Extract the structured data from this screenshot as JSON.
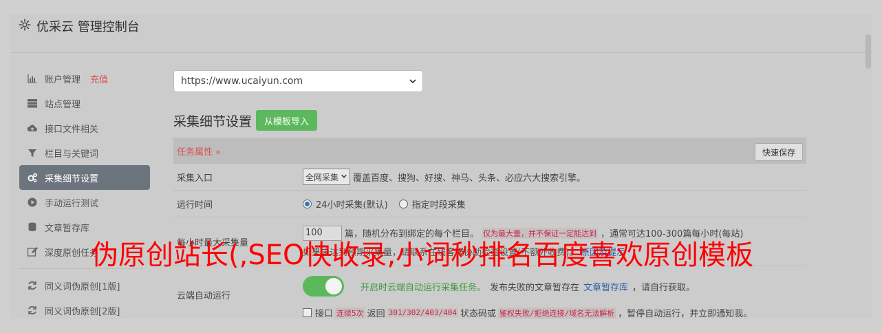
{
  "header": {
    "title": "优采云 管理控制台"
  },
  "sidebar": {
    "items": [
      {
        "label": "账户管理",
        "extra": "充值",
        "icon": "bar-chart-icon"
      },
      {
        "label": "站点管理",
        "icon": "server-icon"
      },
      {
        "label": "接口文件相关",
        "icon": "cloud-upload-icon"
      },
      {
        "label": "栏目与关键词",
        "icon": "filter-icon"
      },
      {
        "label": "采集细节设置",
        "icon": "gears-icon",
        "active": true
      },
      {
        "label": "手动运行测试",
        "icon": "play-circle-icon"
      },
      {
        "label": "文章暂存库",
        "icon": "database-icon"
      },
      {
        "label": "深度原创任务",
        "icon": "edit-icon"
      }
    ],
    "items2": [
      {
        "label": "同义词伪原创[1版]",
        "icon": "refresh-icon"
      },
      {
        "label": "同义词伪原创[2版]",
        "icon": "refresh-icon"
      }
    ]
  },
  "main": {
    "site_select": "https://www.ucaiyun.com",
    "section_title": "采集细节设置",
    "import_button": "从模板导入",
    "task_attr": "任务属性 »",
    "quick_save": "快速保存",
    "rows": {
      "entry": {
        "label": "采集入口",
        "select": "全网采集",
        "desc": "覆盖百度、搜狗、好搜、神马、头条、必应六大搜索引擎。"
      },
      "runtime": {
        "label": "运行时间",
        "opt1": "24小时采集(默认)",
        "opt2": "指定时段采集"
      },
      "max": {
        "label": "每小时最大采集量",
        "value": "100",
        "unit": "篇，随机分布到绑定的每个栏目。",
        "warn": "仅为最大量，并不保证一定能达到",
        "tail": "，通常可达100-300篇每小时(每站)",
        "line2": "如果未达到预期采集量，请联系在线客服协助检查设置(不额外收费)。",
        "reason_link": "原因及提示"
      },
      "cloud": {
        "label": "云端自动运行",
        "on_text": "开启时云端自动运行采集任务。",
        "desc": "发布失败的文章暂存在",
        "store_link": "文章暂存库",
        "desc2": "，请自行获取。",
        "cb_prefix": "接口",
        "cb_red1": "连续5次",
        "cb_mid1": "返回",
        "cb_code": "301/302/403/404",
        "cb_mid2": "状态码或",
        "cb_red2": "鉴权失败/拒绝连接/域名无法解析",
        "cb_tail": "，暂停自动运行，并立即通知我。"
      }
    }
  },
  "watermark": "伪原创站长(,SEO快收录,小词秒排名百度喜欢原创模板"
}
